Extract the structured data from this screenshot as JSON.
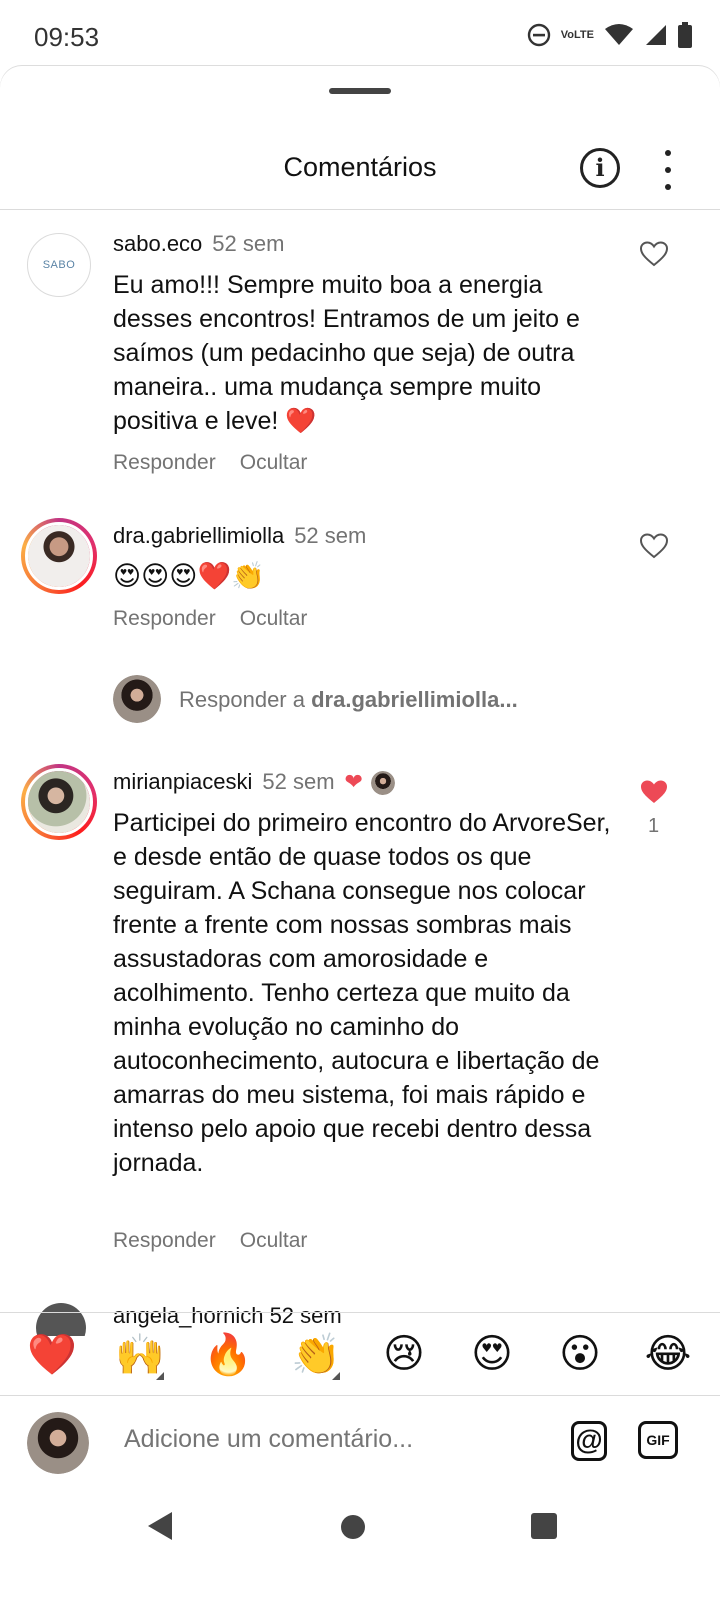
{
  "status_bar": {
    "time": "09:53",
    "icons": [
      "do-not-disturb-icon",
      "volte-lte-icon",
      "wifi-icon",
      "signal-icon",
      "battery-icon"
    ],
    "lte_label_top": "Vo",
    "lte_label_bottom": "LTE"
  },
  "header": {
    "title": "Comentários",
    "info_icon": "i"
  },
  "comments": [
    {
      "username": "sabo.eco",
      "time": "52 sem",
      "text": "Eu amo!!! Sempre muito boa a energia desses encontros! Entramos de um jeito e saímos (um pedacinho que seja) de outra maneira.. uma mudança sempre muito positiva e leve! ❤️",
      "reply_label": "Responder",
      "hide_label": "Ocultar",
      "liked": false,
      "avatar_text": "SABO"
    },
    {
      "username": "dra.gabriellimiolla",
      "time": "52 sem",
      "text": "😍😍😍❤️👏",
      "reply_label": "Responder",
      "hide_label": "Ocultar",
      "liked": false
    },
    {
      "username": "mirianpiaceski",
      "time": "52 sem",
      "author_liked": "❤",
      "text": "Participei do primeiro encontro do ArvoreSer, e desde então de quase todos os que seguiram. A Schana consegue nos colocar frente a frente com nossas sombras mais assustadoras com amorosidade e acolhimento. Tenho certeza que muito da minha evolução no caminho do autoconhecimento, autocura e libertação de amarras do meu sistema, foi mais rápido e intenso pelo apoio que recebi dentro dessa jornada.",
      "reply_label": "Responder",
      "hide_label": "Ocultar",
      "liked": true,
      "like_count": "1"
    }
  ],
  "reply_prompt": {
    "prefix": "Responder a ",
    "username": "dra.gabriellimiolla..."
  },
  "partial_comment": {
    "text": "angela_hornich  52 sem"
  },
  "emoji_bar": [
    "❤️",
    "🙌",
    "🔥",
    "👏",
    "😢",
    "😍",
    "😮",
    "😂"
  ],
  "composer": {
    "placeholder": "Adicione um comentário...",
    "mention_label": "@",
    "gif_label": "GIF"
  },
  "colors": {
    "like_red": "#ed4956",
    "muted_text": "#737373",
    "divider": "#dbdbdb"
  }
}
